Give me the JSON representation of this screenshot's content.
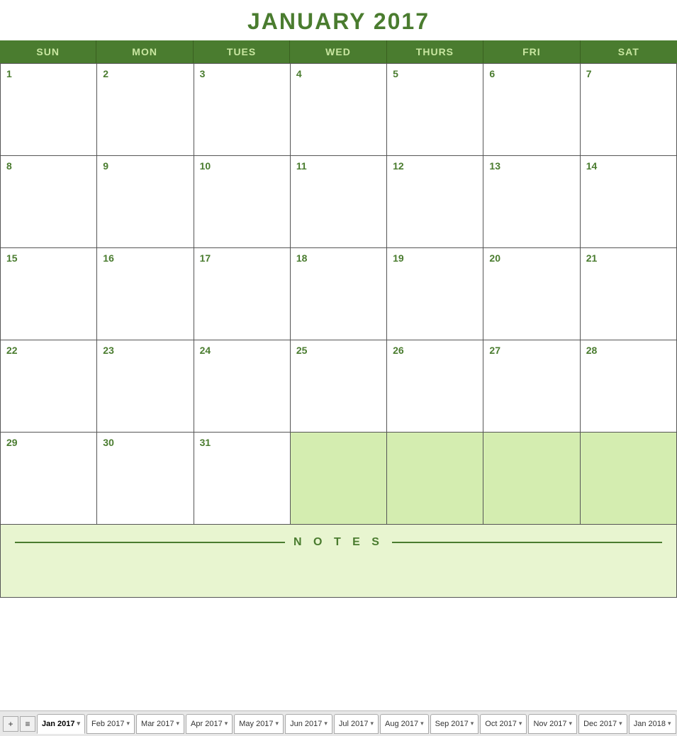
{
  "calendar": {
    "title": "JANUARY 2017",
    "headers": [
      "SUN",
      "MON",
      "TUES",
      "WED",
      "THURS",
      "FRI",
      "SAT"
    ],
    "weeks": [
      [
        {
          "day": "1",
          "empty": false
        },
        {
          "day": "2",
          "empty": false
        },
        {
          "day": "3",
          "empty": false
        },
        {
          "day": "4",
          "empty": false
        },
        {
          "day": "5",
          "empty": false
        },
        {
          "day": "6",
          "empty": false
        },
        {
          "day": "7",
          "empty": false
        }
      ],
      [
        {
          "day": "8",
          "empty": false
        },
        {
          "day": "9",
          "empty": false
        },
        {
          "day": "10",
          "empty": false
        },
        {
          "day": "11",
          "empty": false
        },
        {
          "day": "12",
          "empty": false
        },
        {
          "day": "13",
          "empty": false
        },
        {
          "day": "14",
          "empty": false
        }
      ],
      [
        {
          "day": "15",
          "empty": false
        },
        {
          "day": "16",
          "empty": false
        },
        {
          "day": "17",
          "empty": false
        },
        {
          "day": "18",
          "empty": false
        },
        {
          "day": "19",
          "empty": false
        },
        {
          "day": "20",
          "empty": false
        },
        {
          "day": "21",
          "empty": false
        }
      ],
      [
        {
          "day": "22",
          "empty": false
        },
        {
          "day": "23",
          "empty": false
        },
        {
          "day": "24",
          "empty": false
        },
        {
          "day": "25",
          "empty": false
        },
        {
          "day": "26",
          "empty": false
        },
        {
          "day": "27",
          "empty": false
        },
        {
          "day": "28",
          "empty": false
        }
      ],
      [
        {
          "day": "29",
          "empty": false
        },
        {
          "day": "30",
          "empty": false
        },
        {
          "day": "31",
          "empty": false
        },
        {
          "day": "",
          "empty": true
        },
        {
          "day": "",
          "empty": true
        },
        {
          "day": "",
          "empty": true
        },
        {
          "day": "",
          "empty": true
        }
      ]
    ],
    "notes_label": "N O T E S"
  },
  "tabs": {
    "add_icon": "+",
    "list_icon": "≡",
    "items": [
      {
        "label": "Jan 2017",
        "active": true
      },
      {
        "label": "Feb 2017",
        "active": false
      },
      {
        "label": "Mar 2017",
        "active": false
      },
      {
        "label": "Apr 2017",
        "active": false
      },
      {
        "label": "May 2017",
        "active": false
      },
      {
        "label": "Jun 2017",
        "active": false
      },
      {
        "label": "Jul 2017",
        "active": false
      },
      {
        "label": "Aug 2017",
        "active": false
      },
      {
        "label": "Sep 2017",
        "active": false
      },
      {
        "label": "Oct 2017",
        "active": false
      },
      {
        "label": "Nov 2017",
        "active": false
      },
      {
        "label": "Dec 2017",
        "active": false
      },
      {
        "label": "Jan 2018",
        "active": false
      }
    ]
  }
}
